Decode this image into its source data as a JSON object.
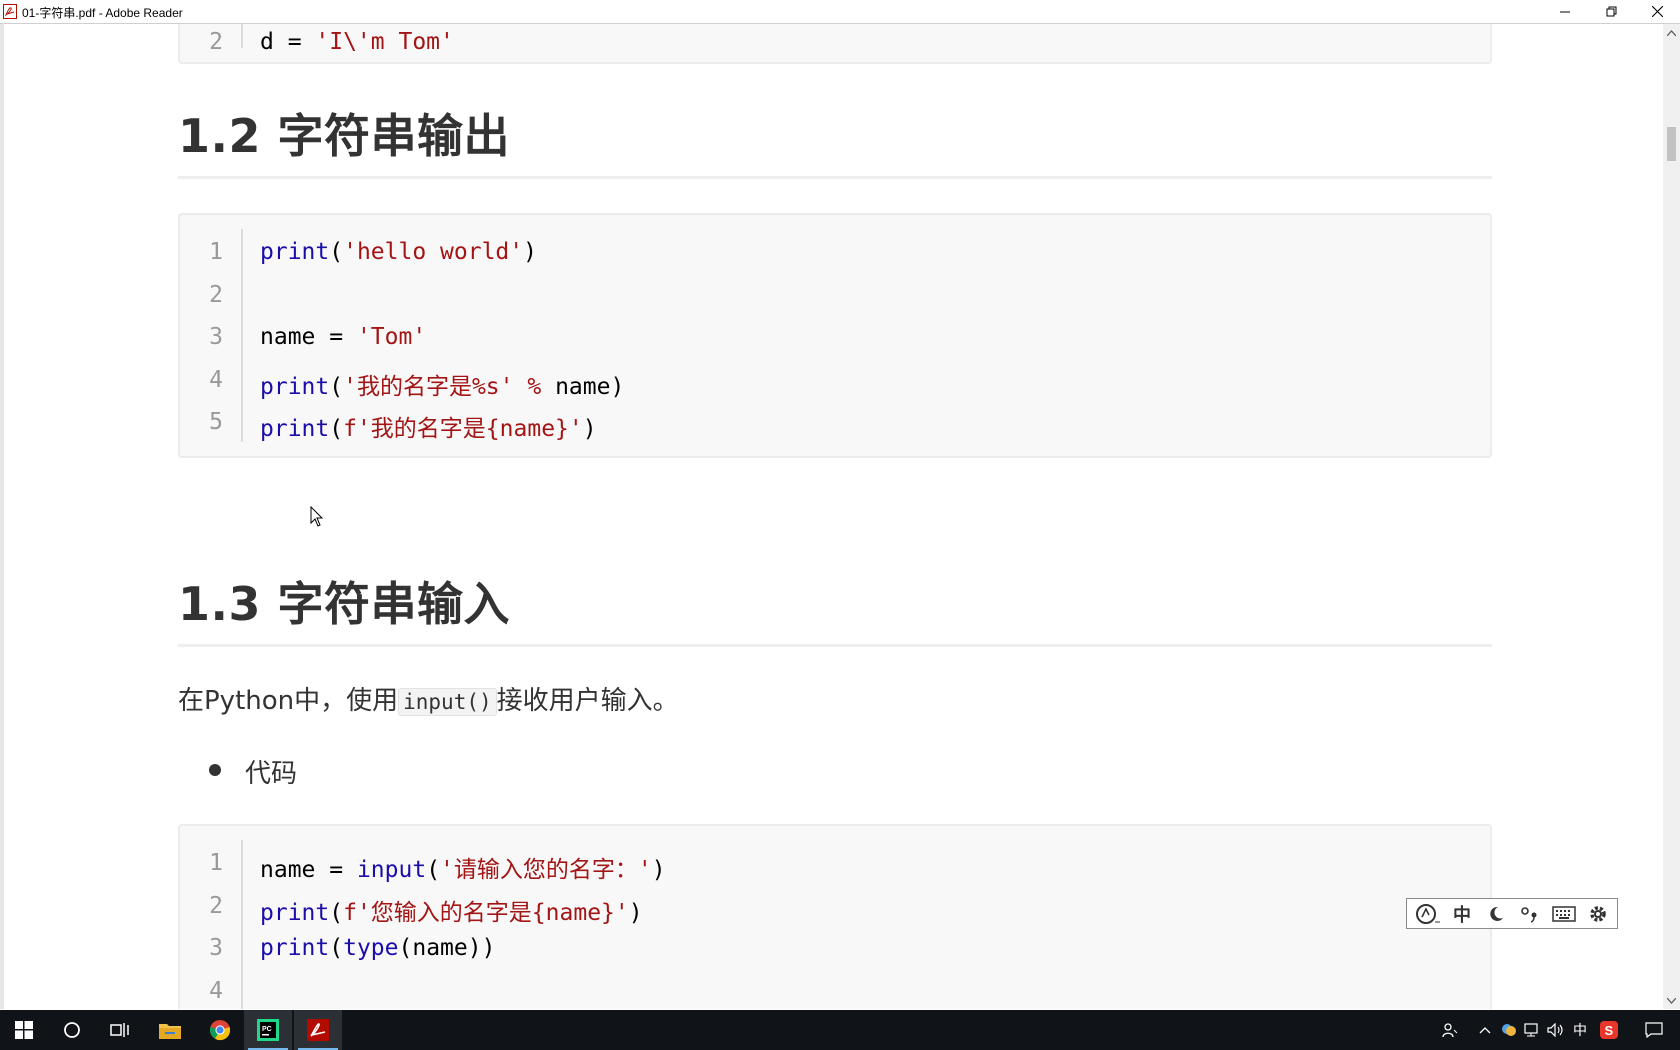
{
  "window": {
    "title": "01-字符串.pdf - Adobe Reader",
    "controls": [
      "minimize",
      "restore",
      "close"
    ]
  },
  "document": {
    "top_code_fragment": {
      "line_number": "2",
      "code": "d = 'I\\'m Tom'"
    },
    "section_output": {
      "heading": "1.2 字符串输出",
      "code_lines": [
        {
          "n": "1",
          "parts": [
            {
              "t": "print",
              "c": "kw"
            },
            {
              "t": "(",
              "c": "op"
            },
            {
              "t": "'hello world'",
              "c": "str"
            },
            {
              "t": ")",
              "c": "op"
            }
          ]
        },
        {
          "n": "2",
          "parts": []
        },
        {
          "n": "3",
          "parts": [
            {
              "t": "name = ",
              "c": "op"
            },
            {
              "t": "'Tom'",
              "c": "str"
            }
          ]
        },
        {
          "n": "4",
          "parts": [
            {
              "t": "print",
              "c": "kw"
            },
            {
              "t": "(",
              "c": "op"
            },
            {
              "t": "'我的名字是%s'",
              "c": "str"
            },
            {
              "t": " ",
              "c": "op"
            },
            {
              "t": "%",
              "c": "str"
            },
            {
              "t": " name)",
              "c": "op"
            }
          ]
        },
        {
          "n": "5",
          "parts": [
            {
              "t": "print",
              "c": "kw"
            },
            {
              "t": "(",
              "c": "op"
            },
            {
              "t": "f'我的名字是{name}'",
              "c": "str"
            },
            {
              "t": ")",
              "c": "op"
            }
          ]
        }
      ]
    },
    "section_input": {
      "heading": "1.3 字符串输入",
      "para_before": "在Python中，使用",
      "para_code": "input()",
      "para_after": "接收用户输入。",
      "bullet": "代码",
      "code_lines": [
        {
          "n": "1",
          "parts": [
            {
              "t": "name = ",
              "c": "op"
            },
            {
              "t": "input",
              "c": "kw"
            },
            {
              "t": "(",
              "c": "op"
            },
            {
              "t": "'请输入您的名字：'",
              "c": "str"
            },
            {
              "t": ")",
              "c": "op"
            }
          ]
        },
        {
          "n": "2",
          "parts": [
            {
              "t": "print",
              "c": "kw"
            },
            {
              "t": "(",
              "c": "op"
            },
            {
              "t": "f'您输入的名字是{name}'",
              "c": "str"
            },
            {
              "t": ")",
              "c": "op"
            }
          ]
        },
        {
          "n": "3",
          "parts": [
            {
              "t": "print",
              "c": "kw"
            },
            {
              "t": "(",
              "c": "op"
            },
            {
              "t": "type",
              "c": "kw"
            },
            {
              "t": "(name))",
              "c": "op"
            }
          ]
        },
        {
          "n": "4",
          "parts": []
        }
      ]
    }
  },
  "ime_toolbar": {
    "mode_label": "中",
    "icons": [
      "ime-logo-icon",
      "moon-icon",
      "punctuation-icon",
      "keyboard-icon",
      "gear-icon"
    ]
  },
  "taskbar": {
    "items": [
      "windows-start-icon",
      "search-circle-icon",
      "task-view-icon",
      "file-explorer-icon",
      "chrome-icon",
      "pycharm-icon",
      "adobe-reader-icon"
    ],
    "tray_ime_label": "中",
    "colors": {
      "bg": "#101418",
      "accent": "#76b9ed"
    }
  },
  "colors": {
    "keyword": "#1b0ea8",
    "string": "#a31515",
    "heading": "#333333",
    "code_bg": "#f8f8f8"
  }
}
